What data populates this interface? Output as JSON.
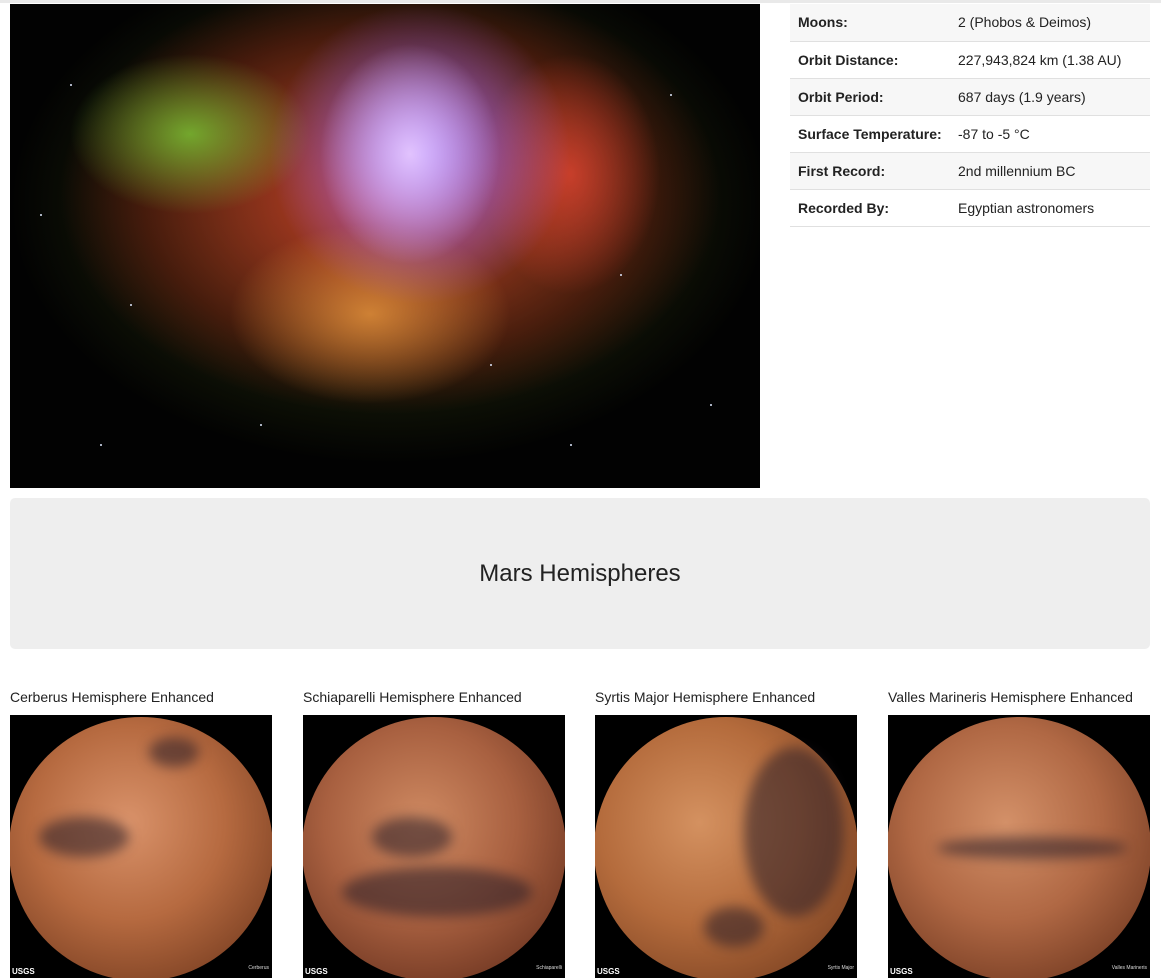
{
  "featured_image": {
    "alt": "Featured Mars image"
  },
  "facts": [
    {
      "label": "Moons:",
      "value": "2 (Phobos & Deimos)"
    },
    {
      "label": "Orbit Distance:",
      "value": "227,943,824 km (1.38 AU)"
    },
    {
      "label": "Orbit Period:",
      "value": "687 days (1.9 years)"
    },
    {
      "label": "Surface Temperature:",
      "value": "-87 to -5 °C"
    },
    {
      "label": "First Record:",
      "value": "2nd millennium BC"
    },
    {
      "label": "Recorded By:",
      "value": "Egyptian astronomers"
    }
  ],
  "hemispheres_section": {
    "title": "Mars Hemispheres"
  },
  "hemispheres": [
    {
      "title": "Cerberus Hemisphere Enhanced",
      "logo": "USGS",
      "caption": "Cerberus"
    },
    {
      "title": "Schiaparelli Hemisphere Enhanced",
      "logo": "USGS",
      "caption": "Schiaparelli"
    },
    {
      "title": "Syrtis Major Hemisphere Enhanced",
      "logo": "USGS",
      "caption": "Syrtis Major"
    },
    {
      "title": "Valles Marineris Hemisphere Enhanced",
      "logo": "USGS",
      "caption": "Valles Marineris"
    }
  ]
}
